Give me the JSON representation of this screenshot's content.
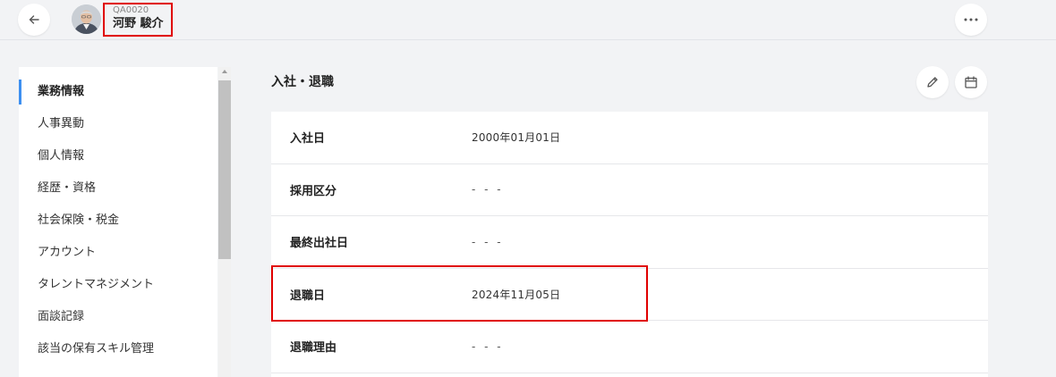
{
  "header": {
    "back_icon": "arrow-left-icon",
    "employee_code": "QA0020",
    "employee_name": "河野 駿介",
    "more_icon": "more-horizontal-icon"
  },
  "sidebar": {
    "items": [
      {
        "label": "業務情報",
        "active": true
      },
      {
        "label": "人事異動",
        "active": false
      },
      {
        "label": "個人情報",
        "active": false
      },
      {
        "label": "経歴・資格",
        "active": false
      },
      {
        "label": "社会保険・税金",
        "active": false
      },
      {
        "label": "アカウント",
        "active": false
      },
      {
        "label": "タレントマネジメント",
        "active": false
      },
      {
        "label": "面談記録",
        "active": false
      },
      {
        "label": "該当の保有スキル管理",
        "active": false
      }
    ]
  },
  "section": {
    "title": "入社・退職",
    "edit_icon": "pencil-icon",
    "calendar_icon": "calendar-icon"
  },
  "fields": [
    {
      "label": "入社日",
      "value": "2000年01月01日"
    },
    {
      "label": "採用区分",
      "value": "- - -"
    },
    {
      "label": "最終出社日",
      "value": "- - -"
    },
    {
      "label": "退職日",
      "value": "2024年11月05日"
    },
    {
      "label": "退職理由",
      "value": "- - -"
    }
  ],
  "colors": {
    "accent": "#3d8ff0",
    "highlight": "#e00000",
    "background": "#f2f3f5"
  }
}
